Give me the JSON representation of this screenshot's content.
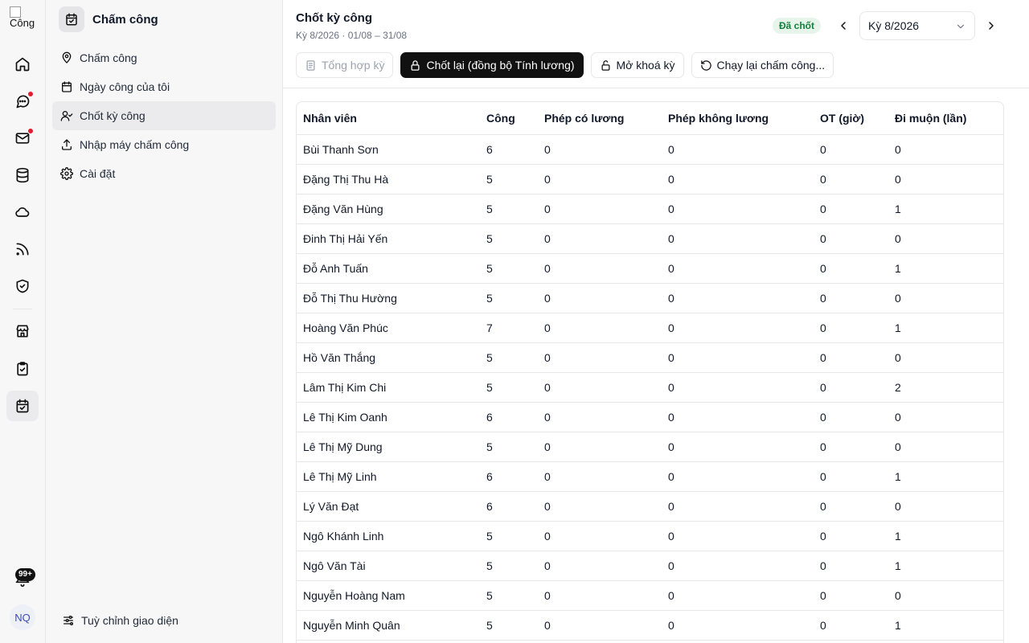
{
  "rail": {
    "logo_alt": "Công",
    "avatar_initials": "NQ",
    "notification_badge": "99+",
    "icons": [
      "home-icon",
      "chat-icon",
      "mail-icon",
      "database-icon",
      "cloud-icon",
      "feed-icon",
      "shield-icon",
      "store-icon",
      "clipboard-icon",
      "calendar-check-icon",
      "bell-icon"
    ]
  },
  "sidebar": {
    "title": "Chấm công",
    "items": [
      {
        "label": "Chấm công",
        "icon": "map-pin-icon"
      },
      {
        "label": "Ngày công của tôi",
        "icon": "calendar-icon"
      },
      {
        "label": "Chốt kỳ công",
        "icon": "user-check-icon"
      },
      {
        "label": "Nhập máy chấm công",
        "icon": "upload-icon"
      },
      {
        "label": "Cài đặt",
        "icon": "gear-icon"
      }
    ],
    "footer_label": "Tuỳ chỉnh giao diện"
  },
  "header": {
    "title": "Chốt kỳ công",
    "subtitle": "Kỳ 8/2026 · 01/08 – 31/08",
    "status": "Đã chốt",
    "period": "Kỳ 8/2026"
  },
  "toolbar": {
    "summarize": "Tổng hợp kỳ",
    "relock": "Chốt lại (đồng bộ Tính lương)",
    "unlock": "Mở khoá kỳ",
    "rerun": "Chạy lại chấm công..."
  },
  "colors": {
    "accent": "#111111",
    "status_bg": "#e7f4ea",
    "status_fg": "#15803d",
    "unread_dot": "#e11d2e"
  },
  "table": {
    "columns": [
      "Nhân viên",
      "Công",
      "Phép có lương",
      "Phép không lương",
      "OT (giờ)",
      "Đi muộn (lần)"
    ],
    "rows": [
      [
        "Bùi Thanh Sơn",
        "6",
        "0",
        "0",
        "0",
        "0"
      ],
      [
        "Đặng Thị Thu Hà",
        "5",
        "0",
        "0",
        "0",
        "0"
      ],
      [
        "Đặng Văn Hùng",
        "5",
        "0",
        "0",
        "0",
        "1"
      ],
      [
        "Đinh Thị Hải Yến",
        "5",
        "0",
        "0",
        "0",
        "0"
      ],
      [
        "Đỗ Anh Tuấn",
        "5",
        "0",
        "0",
        "0",
        "1"
      ],
      [
        "Đỗ Thị Thu Hường",
        "5",
        "0",
        "0",
        "0",
        "0"
      ],
      [
        "Hoàng Văn Phúc",
        "7",
        "0",
        "0",
        "0",
        "1"
      ],
      [
        "Hồ Văn Thắng",
        "5",
        "0",
        "0",
        "0",
        "0"
      ],
      [
        "Lâm Thị Kim Chi",
        "5",
        "0",
        "0",
        "0",
        "2"
      ],
      [
        "Lê Thị Kim Oanh",
        "6",
        "0",
        "0",
        "0",
        "0"
      ],
      [
        "Lê Thị Mỹ Dung",
        "5",
        "0",
        "0",
        "0",
        "0"
      ],
      [
        "Lê Thị Mỹ Linh",
        "6",
        "0",
        "0",
        "0",
        "1"
      ],
      [
        "Lý Văn Đạt",
        "6",
        "0",
        "0",
        "0",
        "0"
      ],
      [
        "Ngô Khánh Linh",
        "5",
        "0",
        "0",
        "0",
        "1"
      ],
      [
        "Ngô Văn Tài",
        "5",
        "0",
        "0",
        "0",
        "1"
      ],
      [
        "Nguyễn Hoàng Nam",
        "5",
        "0",
        "0",
        "0",
        "0"
      ],
      [
        "Nguyễn Minh Quân",
        "5",
        "0",
        "0",
        "0",
        "1"
      ]
    ]
  }
}
